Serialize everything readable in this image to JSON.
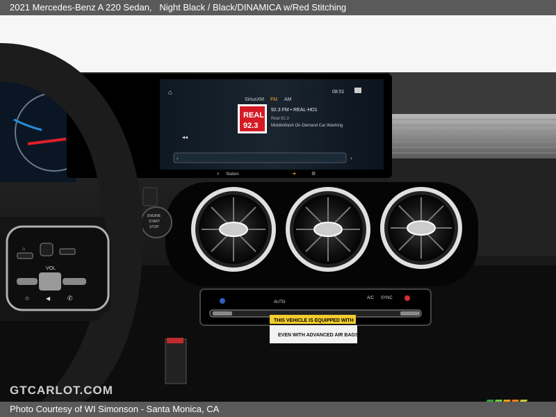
{
  "header": {
    "title": "2021 Mercedes-Benz A 220 Sedan,",
    "detail": "Night Black / Black/DINAMICA w/Red Stitching"
  },
  "screen": {
    "time": "08:51",
    "tabs": [
      "SiriusXM",
      "FM",
      "AM"
    ],
    "station_line": "92.3 FM • REAL-HD1",
    "station_sub": "Real 92.3",
    "program": "MobileWash On-Demand Car Washing",
    "logo_text": "REAL",
    "logo_num": "92.3",
    "search_label": "Station"
  },
  "dash": {
    "engine_label": "ENGINE",
    "start_label": "START",
    "stop_label": "STOP"
  },
  "climate": {
    "labels": [
      "AUTO",
      "A/C",
      "SYNC"
    ]
  },
  "wheel": {
    "vol_label": "VOL"
  },
  "sticker": {
    "line1": "THIS VEHICLE IS EQUIPPED WITH",
    "line2": "EVEN WITH ADVANCED AIR BAGS"
  },
  "watermark": "GTCARLOT.COM",
  "footer": {
    "credit": "Photo Courtesy of WI Simonson - Santa Monica, CA"
  },
  "colors": {
    "bar": "#5a5a5a",
    "logo": [
      "#2e9e3a",
      "#7ac142",
      "#f39c12",
      "#e67e22",
      "#c0d030"
    ]
  }
}
